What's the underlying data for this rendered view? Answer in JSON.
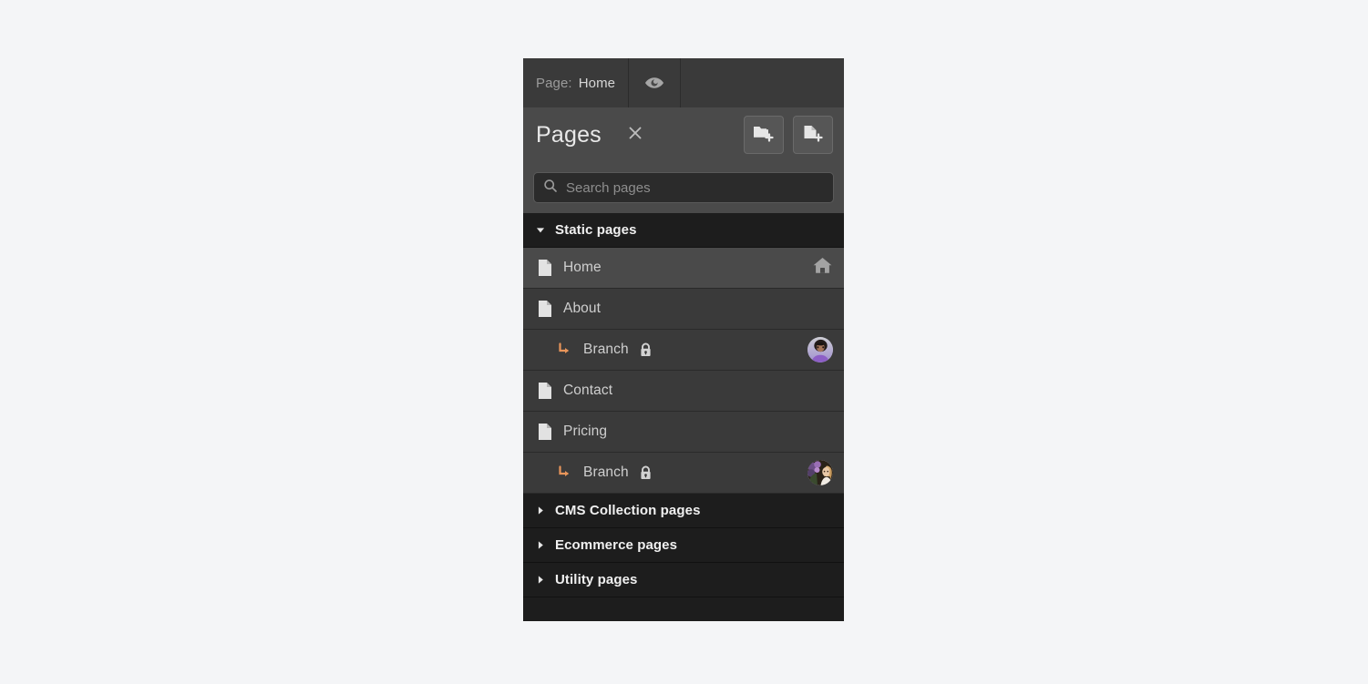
{
  "topbar": {
    "page_label": "Page:",
    "page_value": "Home",
    "eye_icon": "eye-icon"
  },
  "panel": {
    "title": "Pages",
    "close_icon": "close-icon",
    "actions": [
      {
        "name": "new-folder-button",
        "icon": "folder-plus-icon"
      },
      {
        "name": "new-page-button",
        "icon": "page-plus-icon"
      }
    ]
  },
  "search": {
    "icon": "search-icon",
    "value": "",
    "placeholder": "Search pages"
  },
  "groups": [
    {
      "label": "Static pages",
      "expanded": true,
      "caret": "caret-down-icon",
      "items": [
        {
          "label": "Home",
          "type": "page",
          "selected": true,
          "icon": "page-icon",
          "right": "home-icon"
        },
        {
          "label": "About",
          "type": "page",
          "selected": false,
          "icon": "page-icon",
          "right": ""
        },
        {
          "label": "Branch",
          "type": "branch",
          "selected": false,
          "icon": "branch-arrow-icon",
          "lock": "lock-icon",
          "right": "avatar",
          "avatar": "avatar-dark-curly-hair"
        },
        {
          "label": "Contact",
          "type": "page",
          "selected": false,
          "icon": "page-icon",
          "right": ""
        },
        {
          "label": "Pricing",
          "type": "page",
          "selected": false,
          "icon": "page-icon",
          "right": ""
        },
        {
          "label": "Branch",
          "type": "branch",
          "selected": false,
          "icon": "branch-arrow-icon",
          "lock": "lock-icon",
          "right": "avatar",
          "avatar": "avatar-blonde-flowers"
        }
      ]
    },
    {
      "label": "CMS Collection pages",
      "expanded": false,
      "caret": "caret-right-icon",
      "items": []
    },
    {
      "label": "Ecommerce pages",
      "expanded": false,
      "caret": "caret-right-icon",
      "items": []
    },
    {
      "label": "Utility pages",
      "expanded": false,
      "caret": "caret-right-icon",
      "items": []
    }
  ],
  "colors": {
    "page_bg": "#f4f5f7",
    "panel_bg": "#1d1d1d",
    "row_bg": "#3a3a3a",
    "row_selected_bg": "#4a4a4a",
    "header_bg": "#4a4a4a",
    "branch_accent": "#e8955a",
    "text_primary": "#e9e9e9",
    "text_secondary": "#cfcfcf",
    "text_muted": "#8e8e8e"
  }
}
